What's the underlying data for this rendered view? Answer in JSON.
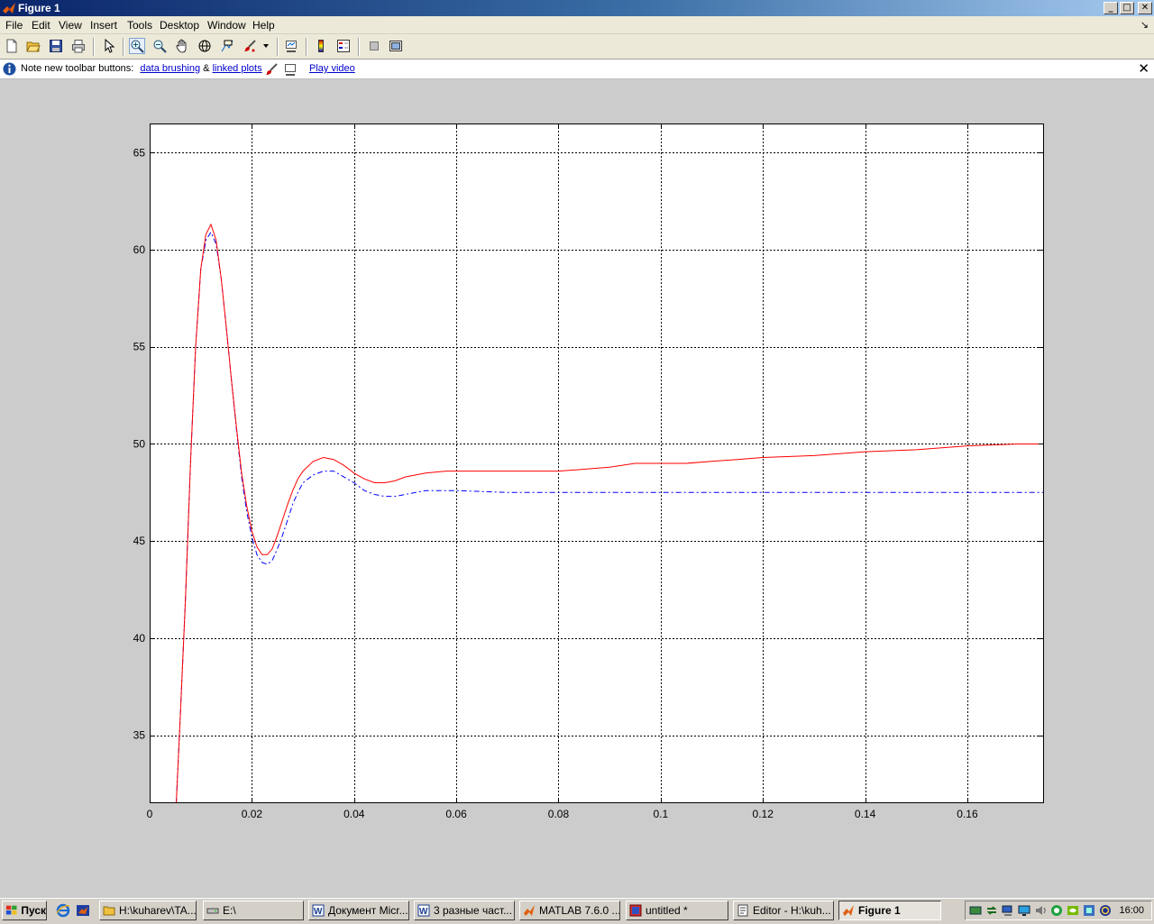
{
  "window": {
    "title": "Figure 1",
    "controls": {
      "minimize": "_",
      "maximize": "□",
      "close": "✕"
    }
  },
  "menu": [
    "File",
    "Edit",
    "View",
    "Insert",
    "Tools",
    "Desktop",
    "Window",
    "Help"
  ],
  "toolbar": {
    "icons": [
      "new-figure-icon",
      "open-file-icon",
      "save-icon",
      "print-icon",
      "select-arrow-icon",
      "zoom-in-icon",
      "zoom-out-icon",
      "pan-hand-icon",
      "rotate-3d-icon",
      "data-cursor-icon",
      "data-brushing-icon",
      "link-plot-icon",
      "colorbar-icon",
      "legend-icon",
      "hide-plot-tools-icon",
      "show-plot-tools-icon"
    ]
  },
  "infobar": {
    "note": "Note new toolbar buttons:",
    "link1": "data brushing",
    "amp": "&",
    "link2": "linked plots",
    "link3": "Play video",
    "close": "✕"
  },
  "chart_data": {
    "type": "line",
    "xlim": [
      0,
      0.175
    ],
    "ylim": [
      31.5,
      66.5
    ],
    "xticks": [
      0,
      0.02,
      0.04,
      0.06,
      0.08,
      0.1,
      0.12,
      0.14,
      0.16
    ],
    "xtick_labels": [
      "0",
      "0.02",
      "0.04",
      "0.06",
      "0.08",
      "0.1",
      "0.12",
      "0.14",
      "0.16"
    ],
    "yticks": [
      35,
      40,
      45,
      50,
      55,
      60,
      65
    ],
    "ytick_labels": [
      "35",
      "40",
      "45",
      "50",
      "55",
      "60",
      "65"
    ],
    "grid": true,
    "series": [
      {
        "color": "#ff0000",
        "style": "solid",
        "x": [
          0.0052,
          0.006,
          0.007,
          0.008,
          0.009,
          0.01,
          0.011,
          0.012,
          0.013,
          0.014,
          0.015,
          0.016,
          0.017,
          0.018,
          0.019,
          0.02,
          0.021,
          0.022,
          0.023,
          0.024,
          0.025,
          0.026,
          0.027,
          0.028,
          0.029,
          0.03,
          0.032,
          0.034,
          0.036,
          0.038,
          0.04,
          0.042,
          0.044,
          0.046,
          0.048,
          0.05,
          0.054,
          0.058,
          0.06,
          0.07,
          0.08,
          0.085,
          0.09,
          0.095,
          0.1,
          0.105,
          0.11,
          0.115,
          0.12,
          0.13,
          0.14,
          0.15,
          0.16,
          0.17,
          0.175
        ],
        "y": [
          31.5,
          36.0,
          42.0,
          49.0,
          55.0,
          59.0,
          60.8,
          61.3,
          60.5,
          58.5,
          56.0,
          53.3,
          50.8,
          48.5,
          46.8,
          45.5,
          44.7,
          44.3,
          44.3,
          44.6,
          45.3,
          46.1,
          46.9,
          47.6,
          48.2,
          48.6,
          49.1,
          49.3,
          49.2,
          48.9,
          48.5,
          48.2,
          48.0,
          48.0,
          48.1,
          48.3,
          48.5,
          48.6,
          48.6,
          48.6,
          48.6,
          48.7,
          48.8,
          49.0,
          49.0,
          49.0,
          49.1,
          49.2,
          49.3,
          49.4,
          49.6,
          49.7,
          49.9,
          50.0,
          50.0
        ]
      },
      {
        "color": "#0000ff",
        "style": "dashdot",
        "x": [
          0.0052,
          0.006,
          0.007,
          0.008,
          0.009,
          0.01,
          0.011,
          0.012,
          0.013,
          0.014,
          0.015,
          0.016,
          0.017,
          0.018,
          0.019,
          0.02,
          0.021,
          0.022,
          0.023,
          0.024,
          0.025,
          0.026,
          0.027,
          0.028,
          0.029,
          0.03,
          0.032,
          0.034,
          0.036,
          0.038,
          0.04,
          0.042,
          0.044,
          0.046,
          0.048,
          0.05,
          0.054,
          0.058,
          0.06,
          0.07,
          0.08,
          0.09,
          0.1,
          0.12,
          0.14,
          0.16,
          0.175
        ],
        "y": [
          31.5,
          36.0,
          42.0,
          49.0,
          55.0,
          59.0,
          60.5,
          60.9,
          60.3,
          58.5,
          56.0,
          53.3,
          50.7,
          48.3,
          46.5,
          45.2,
          44.3,
          43.9,
          43.8,
          44.0,
          44.6,
          45.3,
          46.1,
          46.9,
          47.5,
          48.0,
          48.4,
          48.6,
          48.6,
          48.3,
          48.0,
          47.6,
          47.4,
          47.3,
          47.3,
          47.4,
          47.6,
          47.6,
          47.6,
          47.5,
          47.5,
          47.5,
          47.5,
          47.5,
          47.5,
          47.5,
          47.5
        ]
      }
    ]
  },
  "taskbar": {
    "start": "Пуск",
    "tasks": [
      {
        "label": "H:\\kuharev\\TA...",
        "icon": "folder-icon"
      },
      {
        "label": "E:\\",
        "icon": "drive-icon"
      },
      {
        "label": "Документ Micr...",
        "icon": "word-icon"
      },
      {
        "label": "3 разные част...",
        "icon": "word-icon"
      },
      {
        "label": "MATLAB  7.6.0 ...",
        "icon": "matlab-icon"
      },
      {
        "label": "untitled *",
        "icon": "simulink-icon"
      },
      {
        "label": "Editor - H:\\kuh...",
        "icon": "editor-icon"
      },
      {
        "label": "Figure 1",
        "icon": "matlab-icon",
        "active": true
      }
    ],
    "clock": "16:00"
  }
}
